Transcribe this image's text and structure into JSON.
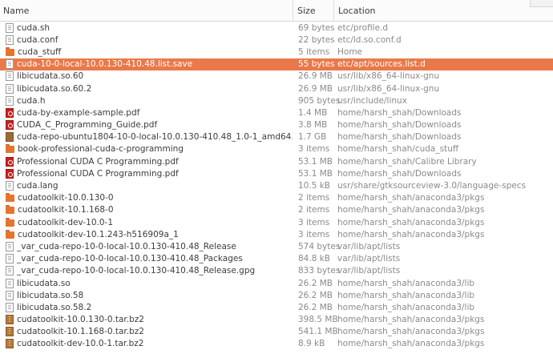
{
  "header": {
    "name": "Name",
    "size": "Size",
    "location": "Location"
  },
  "files": [
    {
      "name": "cuda.sh",
      "size": "69 bytes",
      "location": "etc/profile.d",
      "icon": "text-file-icon",
      "type": "file"
    },
    {
      "name": "cuda.conf",
      "size": "22 bytes",
      "location": "etc/ld.so.conf.d",
      "icon": "text-file-icon",
      "type": "file"
    },
    {
      "name": "cuda_stuff",
      "size": "5 items",
      "location": "Home",
      "icon": "folder-icon",
      "type": "folder"
    },
    {
      "name": "cuda-10-0-local-10.0.130-410.48.list.save",
      "size": "55 bytes",
      "location": "etc/apt/sources.list.d",
      "icon": "text-file-icon",
      "type": "file",
      "selected": true
    },
    {
      "name": "libicudata.so.60",
      "size": "26.9 MB",
      "location": "usr/lib/x86_64-linux-gnu",
      "icon": "text-file-icon",
      "type": "file"
    },
    {
      "name": "libicudata.so.60.2",
      "size": "26.9 MB",
      "location": "usr/lib/x86_64-linux-gnu",
      "icon": "text-file-icon",
      "type": "file"
    },
    {
      "name": "cuda.h",
      "size": "905 bytes",
      "location": "usr/include/linux",
      "icon": "text-file-icon",
      "type": "file"
    },
    {
      "name": "cuda-by-example-sample.pdf",
      "size": "1.4 MB",
      "location": "home/harsh_shah/Downloads",
      "icon": "pdf-icon",
      "type": "pdf"
    },
    {
      "name": "CUDA_C_Programming_Guide.pdf",
      "size": "3.8 MB",
      "location": "home/harsh_shah/Downloads",
      "icon": "pdf-icon",
      "type": "pdf"
    },
    {
      "name": "cuda-repo-ubuntu1804-10-0-local-10.0.130-410.48_1.0-1_amd64.deb",
      "size": "1.7 GB",
      "location": "home/harsh_shah/Downloads",
      "icon": "package-icon",
      "type": "deb"
    },
    {
      "name": "book-professional-cuda-c-programming",
      "size": "3 items",
      "location": "home/harsh_shah/cuda_stuff",
      "icon": "folder-icon",
      "type": "folder"
    },
    {
      "name": "Professional CUDA C Programming.pdf",
      "size": "53.1 MB",
      "location": "home/harsh_shah/Calibre Library",
      "icon": "pdf-icon",
      "type": "pdf"
    },
    {
      "name": "Professional CUDA C Programming.pdf",
      "size": "53.1 MB",
      "location": "home/harsh_shah/Downloads",
      "icon": "pdf-icon",
      "type": "pdf"
    },
    {
      "name": "cuda.lang",
      "size": "10.5 kB",
      "location": "usr/share/gtksourceview-3.0/language-specs",
      "icon": "text-file-icon",
      "type": "file"
    },
    {
      "name": "cudatoolkit-10.0.130-0",
      "size": "2 items",
      "location": "home/harsh_shah/anaconda3/pkgs",
      "icon": "folder-icon",
      "type": "folder"
    },
    {
      "name": "cudatoolkit-10.1.168-0",
      "size": "2 items",
      "location": "home/harsh_shah/anaconda3/pkgs",
      "icon": "folder-icon",
      "type": "folder"
    },
    {
      "name": "cudatoolkit-dev-10.0-1",
      "size": "3 items",
      "location": "home/harsh_shah/anaconda3/pkgs",
      "icon": "folder-icon",
      "type": "folder"
    },
    {
      "name": "cudatoolkit-dev-10.1.243-h516909a_1",
      "size": "3 items",
      "location": "home/harsh_shah/anaconda3/pkgs",
      "icon": "folder-icon",
      "type": "folder"
    },
    {
      "name": "_var_cuda-repo-10-0-local-10.0.130-410.48_Release",
      "size": "574 bytes",
      "location": "var/lib/apt/lists",
      "icon": "text-file-icon",
      "type": "file"
    },
    {
      "name": "_var_cuda-repo-10-0-local-10.0.130-410.48_Packages",
      "size": "84.8 kB",
      "location": "var/lib/apt/lists",
      "icon": "text-file-icon",
      "type": "file"
    },
    {
      "name": "_var_cuda-repo-10-0-local-10.0.130-410.48_Release.gpg",
      "size": "833 bytes",
      "location": "var/lib/apt/lists",
      "icon": "text-file-icon",
      "type": "file"
    },
    {
      "name": "libicudata.so",
      "size": "26.2 MB",
      "location": "home/harsh_shah/anaconda3/lib",
      "icon": "text-file-icon",
      "type": "file"
    },
    {
      "name": "libicudata.so.58",
      "size": "26.2 MB",
      "location": "home/harsh_shah/anaconda3/lib",
      "icon": "text-file-icon",
      "type": "file"
    },
    {
      "name": "libicudata.so.58.2",
      "size": "26.2 MB",
      "location": "home/harsh_shah/anaconda3/lib",
      "icon": "text-file-icon",
      "type": "file"
    },
    {
      "name": "cudatoolkit-10.0.130-0.tar.bz2",
      "size": "398.5 MB",
      "location": "home/harsh_shah/anaconda3/pkgs",
      "icon": "archive-icon",
      "type": "archive"
    },
    {
      "name": "cudatoolkit-10.1.168-0.tar.bz2",
      "size": "541.1 MB",
      "location": "home/harsh_shah/anaconda3/pkgs",
      "icon": "archive-icon",
      "type": "archive"
    },
    {
      "name": "cudatoolkit-dev-10.0-1.tar.bz2",
      "size": "8.9 kB",
      "location": "home/harsh_shah/anaconda3/pkgs",
      "icon": "archive-icon",
      "type": "archive"
    }
  ]
}
